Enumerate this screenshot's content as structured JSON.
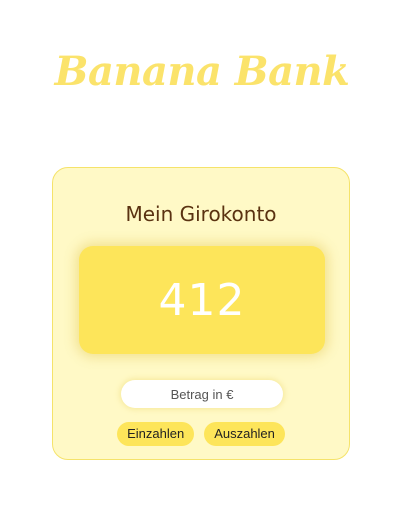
{
  "app": {
    "title": "Banana Bank"
  },
  "account": {
    "title": "Mein Girokonto",
    "balance": "412"
  },
  "amount_input": {
    "placeholder": "Betrag in €",
    "value": ""
  },
  "actions": {
    "deposit_label": "Einzahlen",
    "withdraw_label": "Auszahlen"
  },
  "colors": {
    "brand_yellow": "#fbe36b",
    "card_background": "#fff9c6",
    "balance_background": "#fde55a",
    "title_brown": "#5a3211"
  }
}
